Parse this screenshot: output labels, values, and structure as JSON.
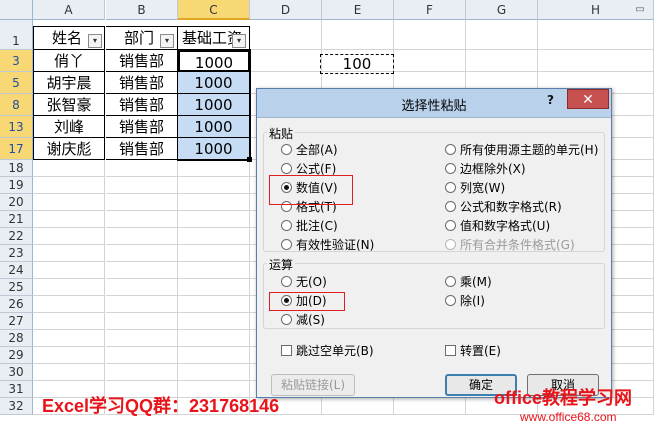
{
  "columns": [
    "A",
    "B",
    "C",
    "D",
    "E",
    "F",
    "G",
    "H"
  ],
  "rows": [
    "1",
    "3",
    "5",
    "8",
    "13",
    "17",
    "18",
    "19",
    "20",
    "21",
    "22",
    "23",
    "24",
    "25",
    "26",
    "27",
    "28",
    "29",
    "30",
    "31",
    "32"
  ],
  "table": {
    "headers": [
      "姓名",
      "部门",
      "基础工资"
    ],
    "data": [
      [
        "俏丫",
        "销售部",
        "1000"
      ],
      [
        "胡宇晨",
        "销售部",
        "1000"
      ],
      [
        "张智豪",
        "销售部",
        "1000"
      ],
      [
        "刘峰",
        "销售部",
        "1000"
      ],
      [
        "谢庆彪",
        "销售部",
        "1000"
      ]
    ]
  },
  "copied_value": "100",
  "dialog": {
    "title": "选择性粘贴",
    "help": "?",
    "close": "✕",
    "paste_group": "粘贴",
    "paste_left": [
      "全部(A)",
      "公式(F)",
      "数值(V)",
      "格式(T)",
      "批注(C)",
      "有效性验证(N)"
    ],
    "paste_right": [
      "所有使用源主题的单元(H)",
      "边框除外(X)",
      "列宽(W)",
      "公式和数字格式(R)",
      "值和数字格式(U)",
      "所有合并条件格式(G)"
    ],
    "op_group": "运算",
    "op_left": [
      "无(O)",
      "加(D)",
      "减(S)"
    ],
    "op_right": [
      "乘(M)",
      "除(I)"
    ],
    "skip_blanks": "跳过空单元(B)",
    "transpose": "转置(E)",
    "paste_link": "粘贴链接(L)",
    "ok": "确定",
    "cancel": "取消"
  },
  "watermark": {
    "qq": "Excel学习QQ群：231768146",
    "site_cn": "office教程学习网",
    "site_url": "www.office68.com"
  },
  "colors": {
    "selected_fill": "#c6dcf5",
    "highlight_box": "#e02020",
    "watermark": "#e8141a"
  }
}
